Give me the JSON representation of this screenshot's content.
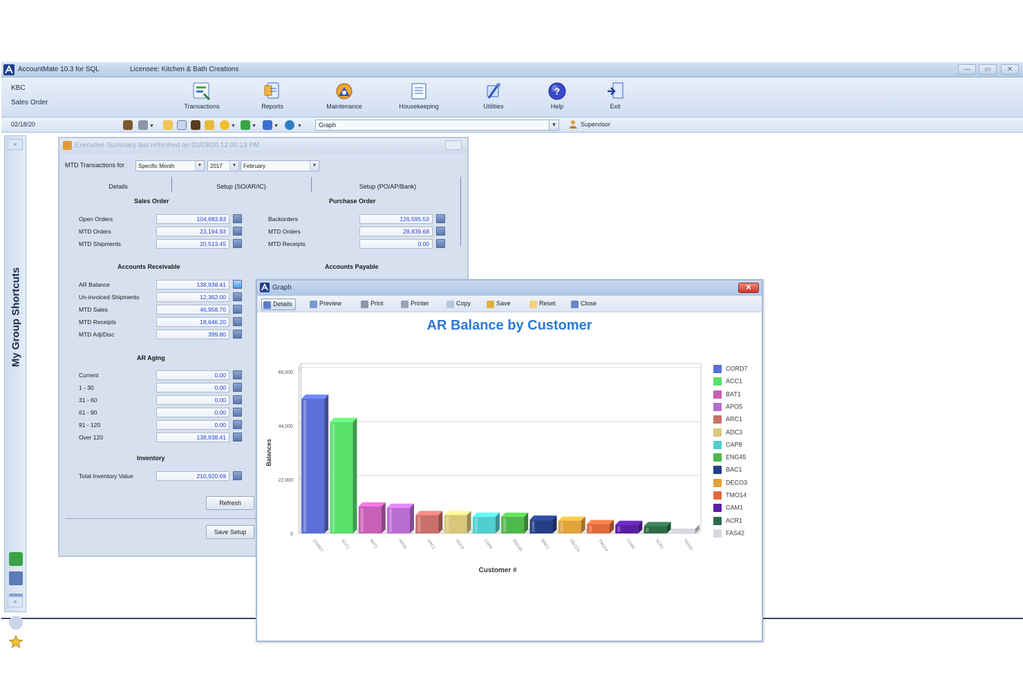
{
  "titlebar": {
    "app": "AccountMate 10.3 for SQL",
    "license": "Licensee: Kitchen & Bath Creations",
    "min": "—",
    "max": "▭",
    "close": "✕"
  },
  "ribbon": {
    "company": "KBC",
    "module": "Sales Order",
    "buttons": [
      {
        "label": "Transactions",
        "icon": "transactions-icon"
      },
      {
        "label": "Reports",
        "icon": "reports-icon"
      },
      {
        "label": "Maintenance",
        "icon": "maintenance-icon"
      },
      {
        "label": "Housekeeping",
        "icon": "housekeeping-icon"
      },
      {
        "label": "Utilities",
        "icon": "utilities-icon"
      },
      {
        "label": "Help",
        "icon": "help-icon"
      },
      {
        "label": "Exit",
        "icon": "exit-icon"
      }
    ]
  },
  "toolbar": {
    "date": "02/18/20",
    "combo_value": "Graph",
    "user": "Supervisor"
  },
  "sidebar": {
    "title": "My Group Shortcuts"
  },
  "exec": {
    "title": "Executive Summary last refreshed on 03/03/20 12:00:13 PM",
    "mtd_label": "MTD Transactions for",
    "period_type": "Specific Month",
    "year": "2017",
    "month": "February",
    "tabs": [
      "Details",
      "Setup (SO/AR/IC)",
      "Setup (PO/AP/Bank)"
    ],
    "sales_order": {
      "heading": "Sales Order",
      "rows": [
        {
          "label": "Open Orders",
          "value": "104,683.83"
        },
        {
          "label": "MTD Orders",
          "value": "23,194.93"
        },
        {
          "label": "MTD Shipments",
          "value": "20,513.45"
        }
      ]
    },
    "purchase_order": {
      "heading": "Purchase Order",
      "rows": [
        {
          "label": "Backorders",
          "value": "126,595.53"
        },
        {
          "label": "MTD Orders",
          "value": "28,839.68"
        },
        {
          "label": "MTD Receipts",
          "value": "0.00"
        }
      ]
    },
    "accounts_receivable": {
      "heading": "Accounts Receivable",
      "rows": [
        {
          "label": "AR Balance",
          "value": "138,938.41"
        },
        {
          "label": "Un-invoiced Shipments",
          "value": "12,362.00"
        },
        {
          "label": "MTD Sales",
          "value": "46,958.70"
        },
        {
          "label": "MTD Receipts",
          "value": "18,646.20"
        },
        {
          "label": "MTD Adj/Disc",
          "value": "399.80"
        }
      ]
    },
    "accounts_payable": {
      "heading": "Accounts Payable"
    },
    "ar_aging": {
      "heading": "AR Aging",
      "rows": [
        {
          "label": "Current",
          "value": "0.00"
        },
        {
          "label": "1 - 30",
          "value": "0.00"
        },
        {
          "label": "31 - 60",
          "value": "0.00"
        },
        {
          "label": "61 - 90",
          "value": "0.00"
        },
        {
          "label": "91 - 120",
          "value": "0.00"
        },
        {
          "label": "Over 120",
          "value": "138,938.41"
        }
      ]
    },
    "inventory": {
      "heading": "Inventory",
      "rows": [
        {
          "label": "Total Inventory Value",
          "value": "210,920.69"
        }
      ]
    },
    "refresh_label": "Refresh",
    "save_setup_label": "Save Setup"
  },
  "graph": {
    "title": "Graph",
    "toolbar": [
      "Details",
      "Preview",
      "Print",
      "Printer",
      "Copy",
      "Save",
      "Reset",
      "Close"
    ],
    "close_glyph": "✕"
  },
  "chart_data": {
    "type": "bar",
    "title": "AR Balance by Customer",
    "xlabel": "Customer #",
    "ylabel": "Balances",
    "ylim": [
      0,
      66000
    ],
    "yticks": [
      "66,000",
      "44,000",
      "22,000",
      "0"
    ],
    "grid": true,
    "legend": "right",
    "categories": [
      "CORD7",
      "ACC1",
      "BAT1",
      "APO5",
      "ARC1",
      "ADC3",
      "CAP8",
      "ENG45",
      "BAC1",
      "DECO3",
      "TMO14",
      "CAM1",
      "ACR1",
      "FAS42"
    ],
    "values": [
      55000,
      45500,
      11000,
      10500,
      7500,
      7500,
      6800,
      6800,
      5600,
      5200,
      3800,
      3500,
      3000,
      2000
    ],
    "colors": [
      "#5b6fd8",
      "#58e06a",
      "#c85fb9",
      "#b96cd2",
      "#c9706a",
      "#d8c77a",
      "#4fcfce",
      "#4fb84a",
      "#243f86",
      "#e2a33a",
      "#e26a3c",
      "#5a1fa5",
      "#2e6b48",
      "#d7d7e0"
    ]
  }
}
